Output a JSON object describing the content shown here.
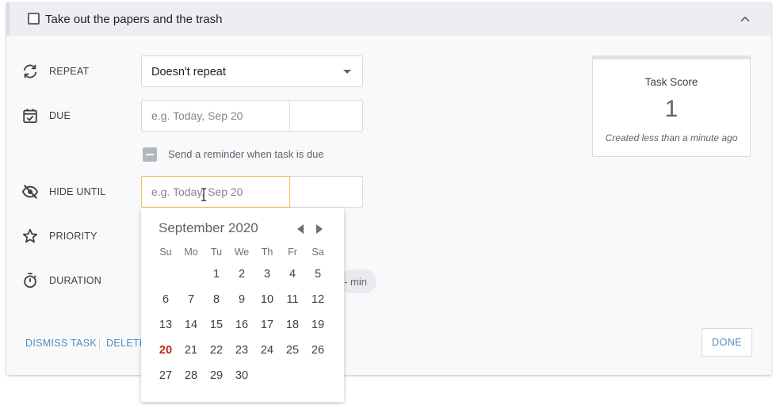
{
  "task": {
    "title": "Take out the papers and the trash",
    "completed": false
  },
  "repeat": {
    "label": "REPEAT",
    "value": "Doesn't repeat"
  },
  "due": {
    "label": "DUE",
    "date_placeholder": "e.g. Today, Sep 20",
    "time_value": ""
  },
  "reminder": {
    "label": "Send a reminder when task is due"
  },
  "hide_until": {
    "label": "HIDE UNTIL",
    "date_placeholder": "e.g. Today, Sep 20",
    "time_value": ""
  },
  "priority": {
    "label": "PRIORITY"
  },
  "duration": {
    "label": "DURATION",
    "chip_text": "- min"
  },
  "footer": {
    "dismiss_label": "DISMISS TASK",
    "delete_label": "DELETE",
    "done_label": "DONE"
  },
  "score": {
    "title": "Task Score",
    "value": "1",
    "note": "Created less than a minute ago"
  },
  "calendar": {
    "month_label": "September 2020",
    "weekdays": [
      "Su",
      "Mo",
      "Tu",
      "We",
      "Th",
      "Fr",
      "Sa"
    ],
    "weeks": [
      [
        "",
        "",
        "1",
        "2",
        "3",
        "4",
        "5"
      ],
      [
        "6",
        "7",
        "8",
        "9",
        "10",
        "11",
        "12"
      ],
      [
        "13",
        "14",
        "15",
        "16",
        "17",
        "18",
        "19"
      ],
      [
        "20",
        "21",
        "22",
        "23",
        "24",
        "25",
        "26"
      ],
      [
        "27",
        "28",
        "29",
        "30",
        "",
        "",
        ""
      ]
    ],
    "today": "20",
    "today_color": "#c5221f"
  },
  "colors": {
    "accent_link": "#4a90c2",
    "focus_border": "#f2c04c"
  },
  "icons": {
    "repeat": "repeat-icon",
    "due": "calendar-check-icon",
    "hide_until": "eye-off-icon",
    "priority": "star-outline-icon",
    "duration": "stopwatch-icon",
    "collapse": "chevron-up-icon"
  }
}
